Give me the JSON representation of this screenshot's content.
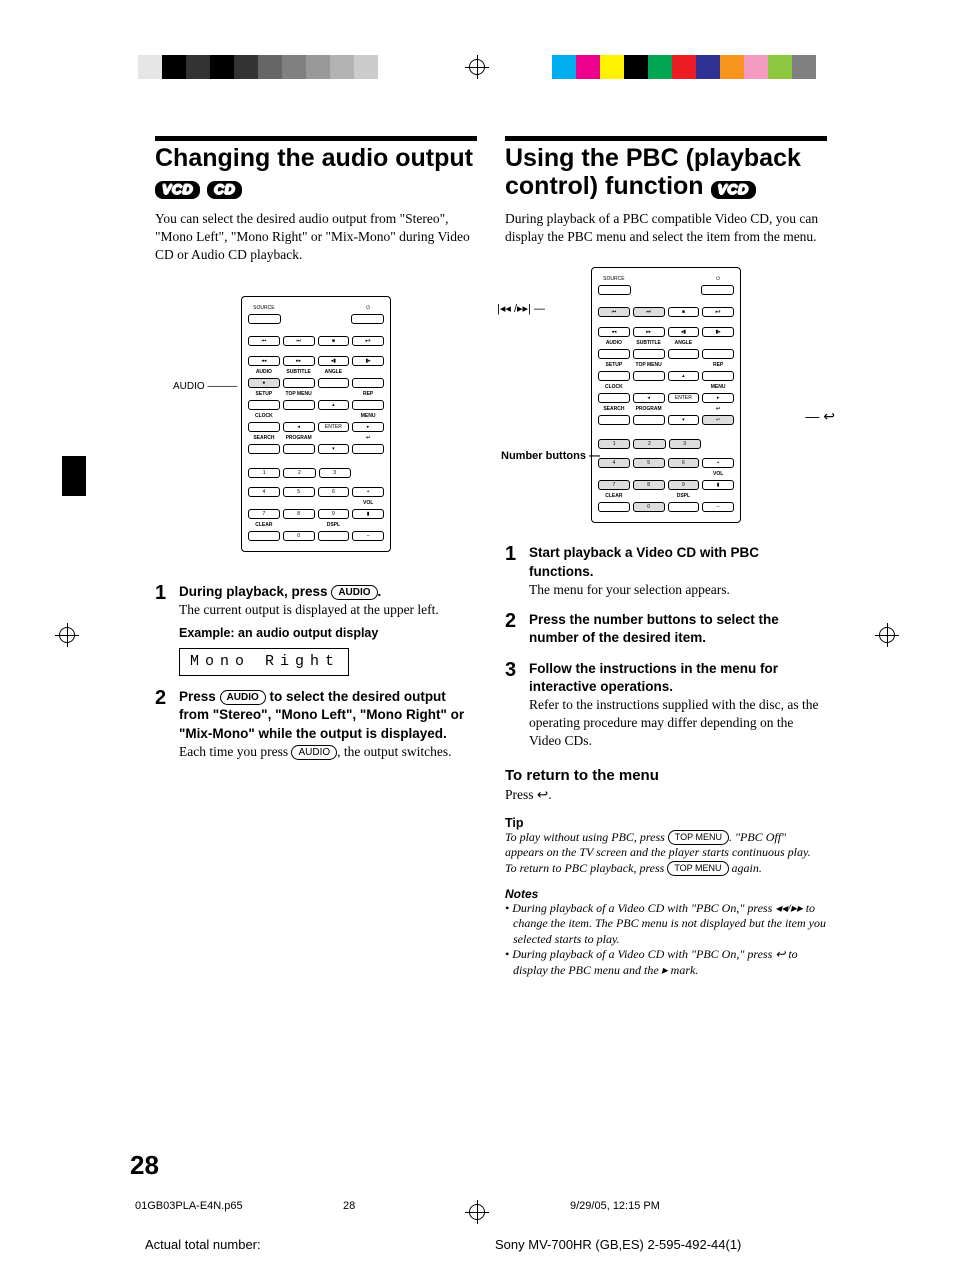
{
  "color_bars_left": [
    "#e6e6e6",
    "#000000",
    "#333333",
    "#000000",
    "#333333",
    "#666666",
    "#808080",
    "#999999",
    "#b3b3b3",
    "#cccccc"
  ],
  "color_bars_right": [
    "#00aeef",
    "#ec008c",
    "#fff200",
    "#000000",
    "#00a651",
    "#ed1c24",
    "#2e3192",
    "#f7941e",
    "#f49ac1",
    "#8dc63f",
    "#808080"
  ],
  "left_col": {
    "title": "Changing the audio output",
    "badges": [
      "VCD",
      "CD"
    ],
    "intro": "You can select the desired audio output from \"Stereo\", \"Mono Left\", \"Mono Right\" or \"Mix-Mono\" during Video CD or Audio CD playback.",
    "remote_callout": "AUDIO",
    "step1": {
      "lead_pre": "During playback, press ",
      "pill": "AUDIO",
      "lead_post": ".",
      "body": "The current output is displayed at the upper left.",
      "example_label": "Example: an audio output display",
      "example_value": "Mono Right"
    },
    "step2": {
      "lead_pre": "Press ",
      "pill": "AUDIO",
      "lead_post": " to select the desired output from \"Stereo\", \"Mono Left\", \"Mono Right\" or \"Mix-Mono\" while the output is displayed.",
      "body_pre": "Each time you press ",
      "body_pill": "AUDIO",
      "body_post": ", the output switches."
    }
  },
  "right_col": {
    "title": "Using the PBC (playback control) function",
    "badges": [
      "VCD"
    ],
    "intro": "During playback of a PBC compatible Video CD, you can display the PBC menu and select the item from the menu.",
    "remote_callouts": {
      "prev_next": "◂◂ / ▸▸",
      "number": "Number buttons",
      "return": "↩"
    },
    "step1": {
      "lead": "Start playback a Video CD with PBC functions.",
      "body": "The menu for your selection appears."
    },
    "step2": {
      "lead": "Press the number buttons to select the number of the desired item."
    },
    "step3": {
      "lead": "Follow the instructions in the menu for interactive operations.",
      "body": "Refer to the instructions supplied with the disc, as the operating procedure may differ depending on the Video CDs."
    },
    "return_head": "To return to the menu",
    "return_body": "Press ↩.",
    "tip_head": "Tip",
    "tip_line1_pre": "To play without using PBC, press ",
    "tip_pill1": "TOP MENU",
    "tip_line1_post": ". \"PBC Off\" appears on the TV screen and the player starts continuous play.",
    "tip_line2_pre": "To return to PBC playback, press ",
    "tip_pill2": "TOP MENU",
    "tip_line2_post": " again.",
    "notes_head": "Notes",
    "notes": [
      "During playback of a Video CD with \"PBC On,\" press ◂◂/▸▸ to change the item. The PBC menu is not displayed but the item you selected starts to play.",
      "During playback of a Video CD with \"PBC On,\" press ↩ to display the PBC menu and the ▸ mark."
    ]
  },
  "remote_labels": {
    "source": "SOURCE",
    "audio": "AUDIO",
    "subtitle": "SUBTITLE",
    "angle": "ANGLE",
    "rep": "REP",
    "setup": "SETUP",
    "topmenu": "TOP MENU",
    "menu": "MENU",
    "clock": "CLOCK",
    "enter": "ENTER",
    "search": "SEARCH",
    "program": "PROGRAM",
    "clear": "CLEAR",
    "dspl": "DSPL",
    "vol": "VOL"
  },
  "page_number": "28",
  "footer": {
    "file": "01GB03PLA-E4N.p65",
    "page": "28",
    "date": "9/29/05, 12:15 PM",
    "actual": "Actual total number:",
    "model": "Sony MV-700HR (GB,ES) 2-595-492-44(1)"
  }
}
